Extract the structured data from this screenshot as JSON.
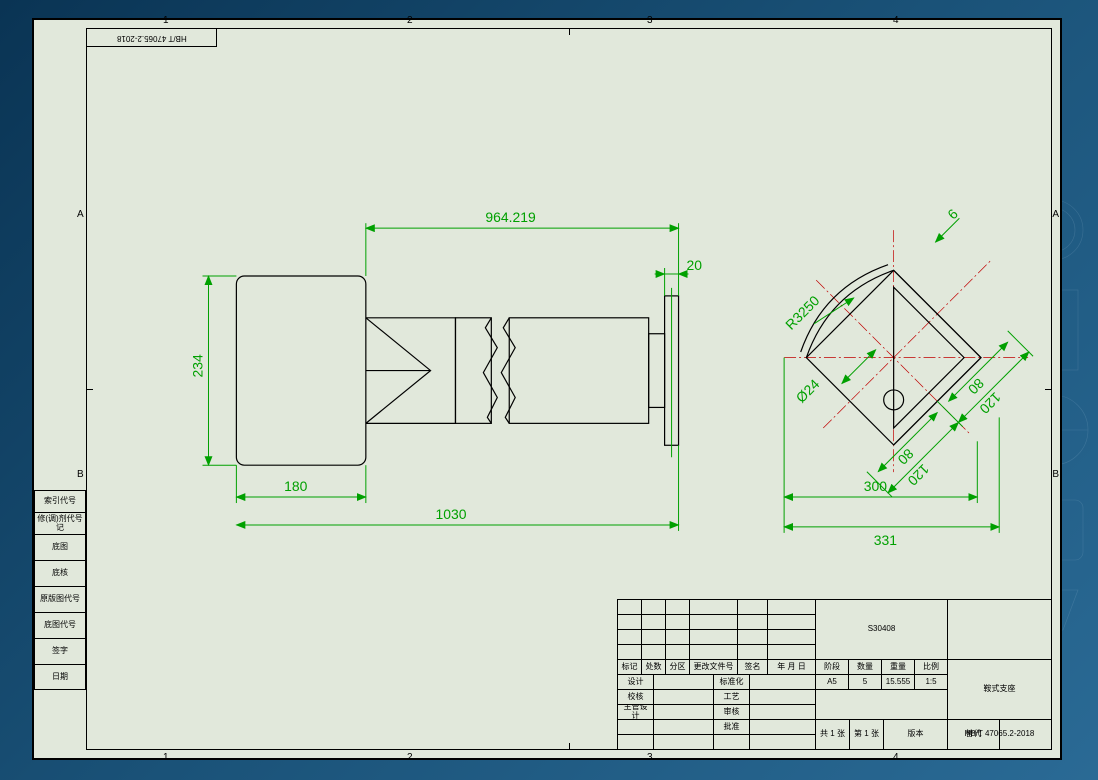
{
  "meta": {
    "standard_code_top": "HB/T 47065.2-2018",
    "standard_code_bottom": "HB/T 47065.2-2018",
    "zone_a": "A",
    "zone_b": "B",
    "ruler_1": "1",
    "ruler_2": "2",
    "ruler_3": "3",
    "ruler_4": "4"
  },
  "dimensions": {
    "d_964_219": "964.219",
    "d_20": "20",
    "d_234": "234",
    "d_180": "180",
    "d_1030": "1030",
    "d_300": "300",
    "d_331": "331",
    "d_6": "6",
    "d_120a": "120",
    "d_80a": "80",
    "d_80b": "80",
    "d_120b": "120",
    "r_325": "R3250",
    "phi_24": "Ø24"
  },
  "side_table": {
    "r0": "索引代号",
    "r1": "修(调)剂代号记",
    "r2": "底图",
    "r3": "底核",
    "r4": "原版图代号",
    "r5": "底图代号",
    "r6": "签字",
    "r7": "日期"
  },
  "title_block": {
    "material": "S30408",
    "part_name": "鞍式支座",
    "rev_header": {
      "c0": "标记",
      "c1": "处数",
      "c2": "分区",
      "c3": "更改文件号",
      "c4": "签名",
      "c5": "年 月 日"
    },
    "roles": {
      "r0": "设计",
      "r1": "校核",
      "r2": "主管设计",
      "r3": "标准化",
      "r4": "工艺",
      "r5": "审核",
      "r6": "批准"
    },
    "specs_header": {
      "c0": "阶段",
      "c1": "数量",
      "c2": "重量",
      "c3": "比例"
    },
    "specs_values": {
      "c0": "A5",
      "c1": "5",
      "c2": "15.555",
      "c3": "1:5"
    },
    "sheet_info": {
      "left": "共 1 张",
      "mid": "第 1 张",
      "right": "版本"
    },
    "replace_label": "替代"
  }
}
